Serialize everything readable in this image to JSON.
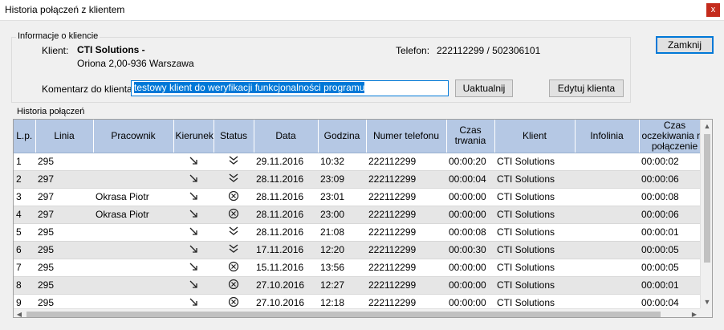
{
  "window": {
    "title": "Historia połączeń z klientem",
    "close_label": "x"
  },
  "client_info": {
    "group_label": "Informacje o kliencie",
    "client_label": "Klient:",
    "client_name": "CTI Solutions -",
    "client_address": "Oriona 2,00-936 Warszawa",
    "phone_label": "Telefon:",
    "phone_value": "222112299 / 502306101",
    "comment_label": "Komentarz do klienta:",
    "comment_value": "testowy klient do weryfikacji funkcjonalności programu",
    "update_button": "Uaktualnij",
    "edit_button": "Edytuj klienta"
  },
  "close_button": "Zamknij",
  "history": {
    "label": "Historia połączeń",
    "columns": [
      "L.p.",
      "Linia",
      "Pracownik",
      "Kierunek",
      "Status",
      "Data",
      "Godzina",
      "Numer telefonu",
      "Czas trwania",
      "Klient",
      "Infolinia",
      "Czas oczekiwania na połączenie"
    ],
    "rows": [
      {
        "lp": "1",
        "linia": "295",
        "pracownik": "",
        "kierunek": "arrow-down-right-icon",
        "status": "double-chevron-down-icon",
        "data": "29.11.2016",
        "godzina": "10:32",
        "numer": "222112299",
        "czas": "00:00:20",
        "klient": "CTI Solutions",
        "infolinia": "",
        "oczekiwanie": "00:00:02"
      },
      {
        "lp": "2",
        "linia": "297",
        "pracownik": "",
        "kierunek": "arrow-down-right-icon",
        "status": "double-chevron-down-icon",
        "data": "28.11.2016",
        "godzina": "23:09",
        "numer": "222112299",
        "czas": "00:00:04",
        "klient": "CTI Solutions",
        "infolinia": "",
        "oczekiwanie": "00:00:06"
      },
      {
        "lp": "3",
        "linia": "297",
        "pracownik": "Okrasa Piotr",
        "kierunek": "arrow-down-right-icon",
        "status": "circle-x-icon",
        "data": "28.11.2016",
        "godzina": "23:01",
        "numer": "222112299",
        "czas": "00:00:00",
        "klient": "CTI Solutions",
        "infolinia": "",
        "oczekiwanie": "00:00:08"
      },
      {
        "lp": "4",
        "linia": "297",
        "pracownik": "Okrasa Piotr",
        "kierunek": "arrow-down-right-icon",
        "status": "circle-x-icon",
        "data": "28.11.2016",
        "godzina": "23:00",
        "numer": "222112299",
        "czas": "00:00:00",
        "klient": "CTI Solutions",
        "infolinia": "",
        "oczekiwanie": "00:00:06"
      },
      {
        "lp": "5",
        "linia": "295",
        "pracownik": "",
        "kierunek": "arrow-down-right-icon",
        "status": "double-chevron-down-icon",
        "data": "28.11.2016",
        "godzina": "21:08",
        "numer": "222112299",
        "czas": "00:00:08",
        "klient": "CTI Solutions",
        "infolinia": "",
        "oczekiwanie": "00:00:01"
      },
      {
        "lp": "6",
        "linia": "295",
        "pracownik": "",
        "kierunek": "arrow-down-right-icon",
        "status": "double-chevron-down-icon",
        "data": "17.11.2016",
        "godzina": "12:20",
        "numer": "222112299",
        "czas": "00:00:30",
        "klient": "CTI Solutions",
        "infolinia": "",
        "oczekiwanie": "00:00:05"
      },
      {
        "lp": "7",
        "linia": "295",
        "pracownik": "",
        "kierunek": "arrow-down-right-icon",
        "status": "circle-x-icon",
        "data": "15.11.2016",
        "godzina": "13:56",
        "numer": "222112299",
        "czas": "00:00:00",
        "klient": "CTI Solutions",
        "infolinia": "",
        "oczekiwanie": "00:00:05"
      },
      {
        "lp": "8",
        "linia": "295",
        "pracownik": "",
        "kierunek": "arrow-down-right-icon",
        "status": "circle-x-icon",
        "data": "27.10.2016",
        "godzina": "12:27",
        "numer": "222112299",
        "czas": "00:00:00",
        "klient": "CTI Solutions",
        "infolinia": "",
        "oczekiwanie": "00:00:01"
      },
      {
        "lp": "9",
        "linia": "295",
        "pracownik": "",
        "kierunek": "arrow-down-right-icon",
        "status": "circle-x-icon",
        "data": "27.10.2016",
        "godzina": "12:18",
        "numer": "222112299",
        "czas": "00:00:00",
        "klient": "CTI Solutions",
        "infolinia": "",
        "oczekiwanie": "00:00:04"
      }
    ]
  },
  "colors": {
    "header_bg": "#b5c8e4",
    "row_alt_bg": "#e6e6e6",
    "selection": "#0078d7",
    "close_red": "#c42b1c"
  }
}
